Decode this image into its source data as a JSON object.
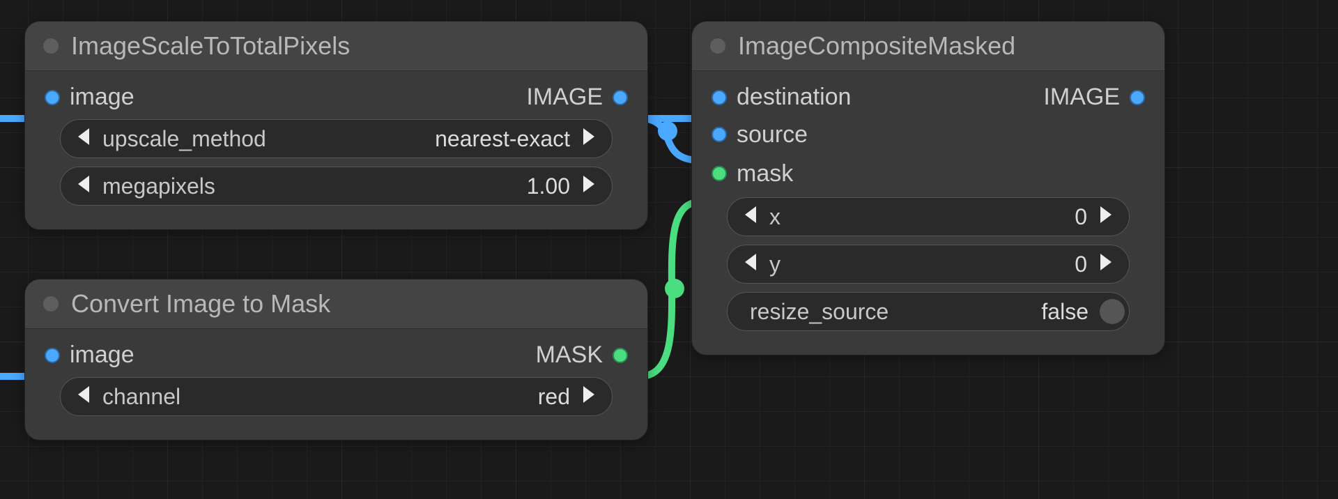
{
  "nodes": {
    "scale": {
      "title": "ImageScaleToTotalPixels",
      "inputs": {
        "image": "image"
      },
      "outputs": {
        "image": "IMAGE"
      },
      "widgets": {
        "upscale_method": {
          "label": "upscale_method",
          "value": "nearest-exact"
        },
        "megapixels": {
          "label": "megapixels",
          "value": "1.00"
        }
      }
    },
    "convert": {
      "title": "Convert Image to Mask",
      "inputs": {
        "image": "image"
      },
      "outputs": {
        "mask": "MASK"
      },
      "widgets": {
        "channel": {
          "label": "channel",
          "value": "red"
        }
      }
    },
    "composite": {
      "title": "ImageCompositeMasked",
      "inputs": {
        "destination": "destination",
        "source": "source",
        "mask": "mask"
      },
      "outputs": {
        "image": "IMAGE"
      },
      "widgets": {
        "x": {
          "label": "x",
          "value": "0"
        },
        "y": {
          "label": "y",
          "value": "0"
        },
        "resize_source": {
          "label": "resize_source",
          "value": "false"
        }
      }
    }
  },
  "colors": {
    "image_port": "#4aa8ff",
    "mask_port": "#4ade80"
  }
}
